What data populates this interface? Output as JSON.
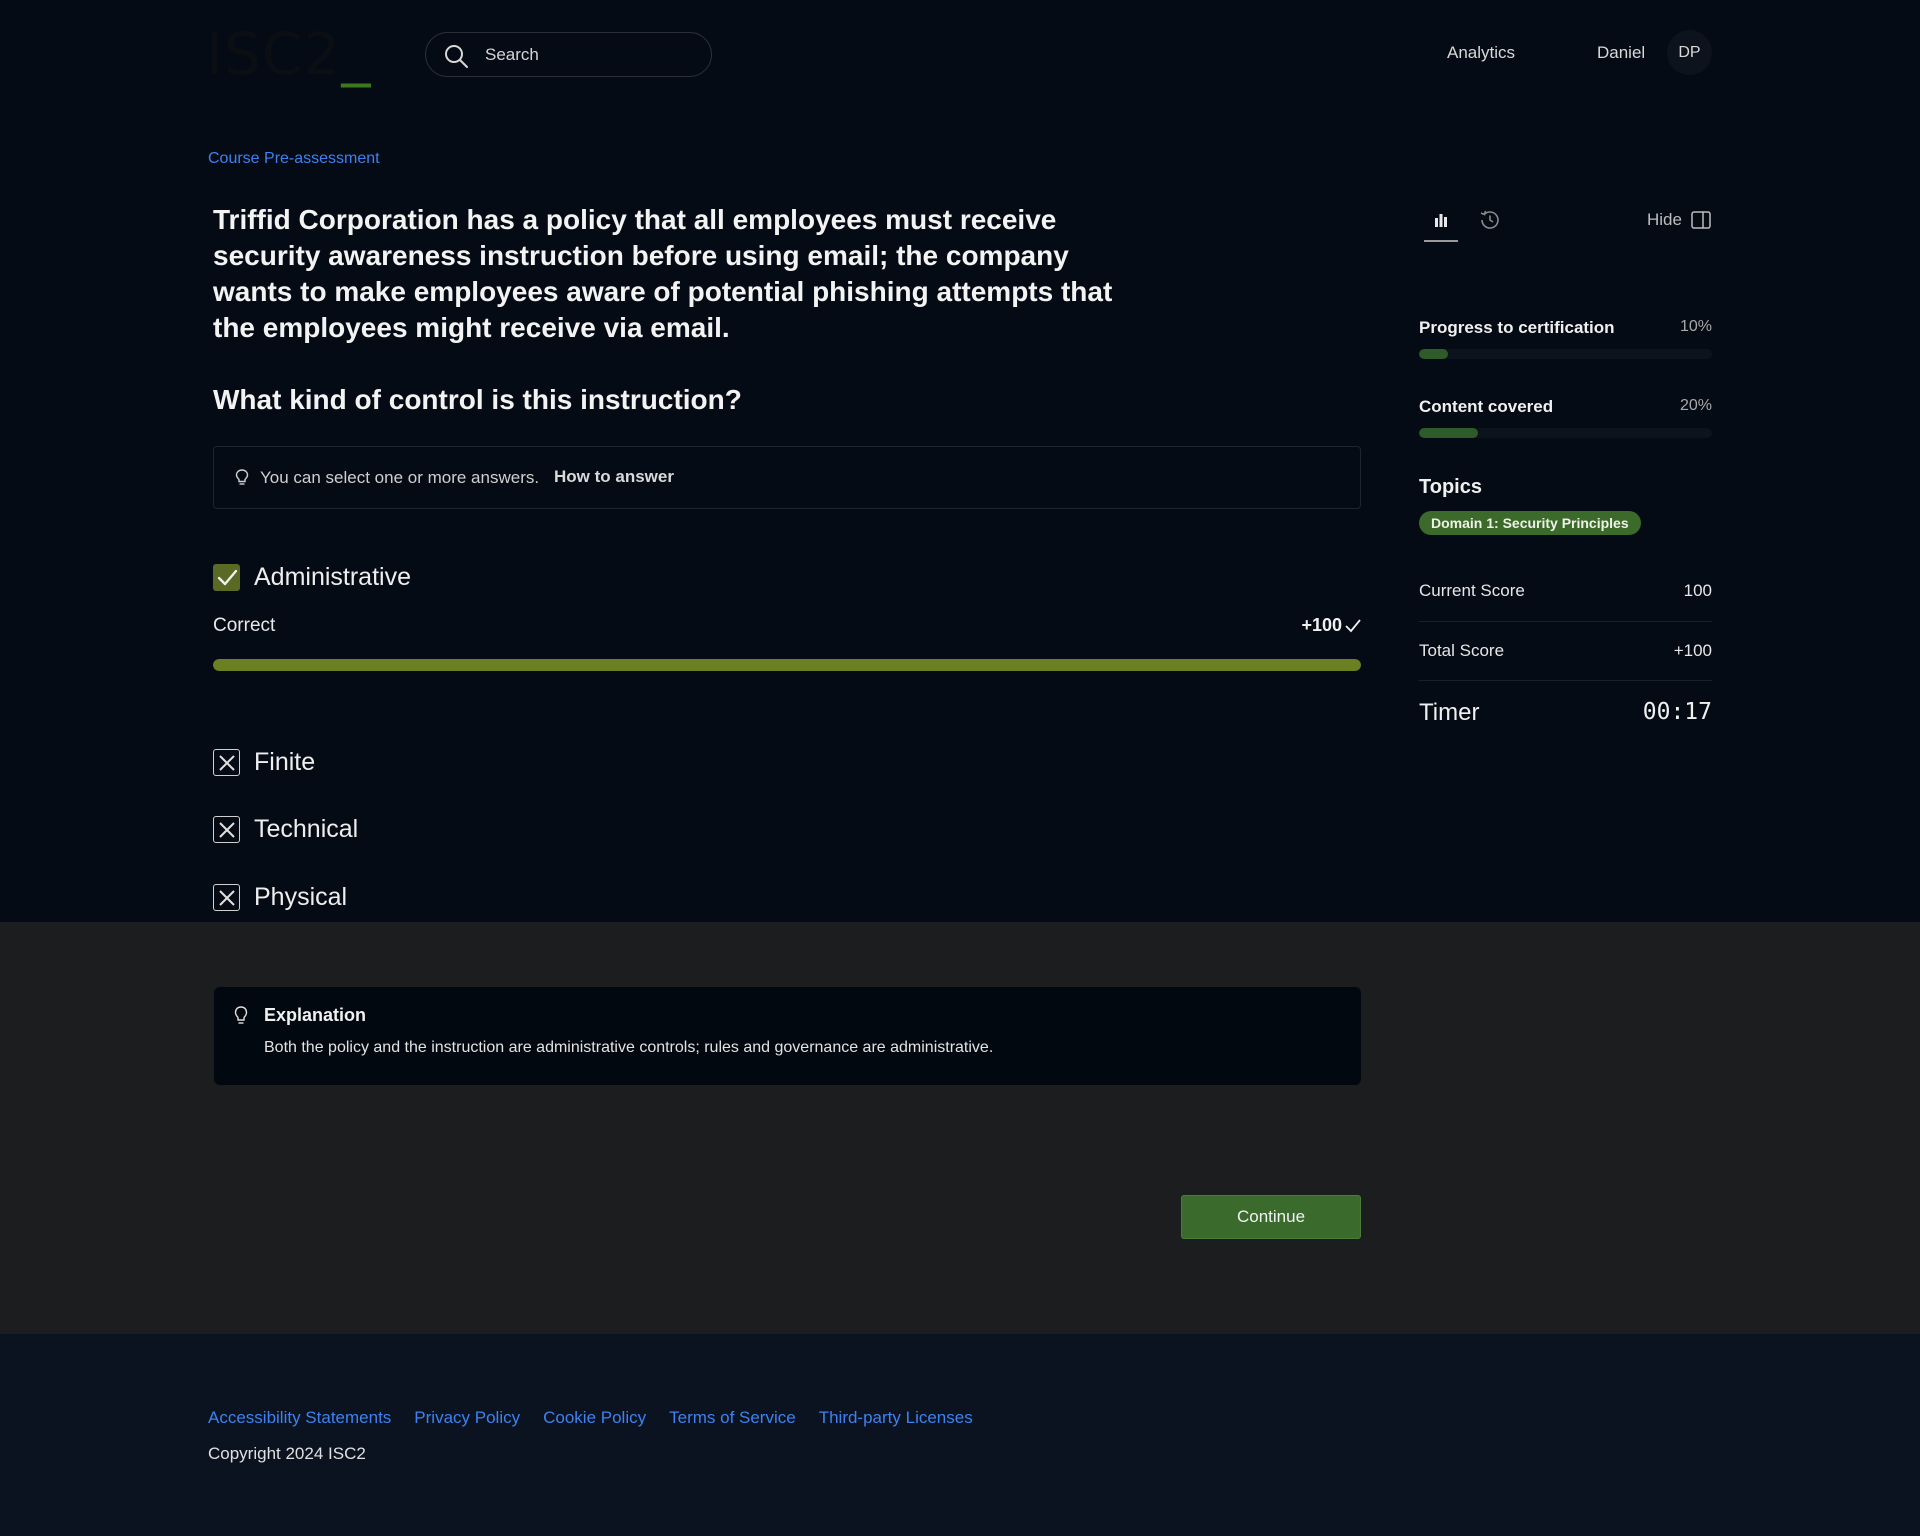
{
  "header": {
    "logo_text": "ISC2",
    "search_placeholder": "Search",
    "nav_analytics": "Analytics",
    "user_name": "Daniel",
    "avatar_initials": "DP"
  },
  "breadcrumb": "Course Pre-assessment",
  "question": {
    "stem": "Triffid Corporation has a policy that all employees must receive security awareness instruction before using email; the company wants to make employees aware of potential phishing attempts that the employees might receive via email.",
    "prompt": "What kind of control is this instruction?",
    "hint_text": "You can select one or more answers.",
    "hint_link": "How to answer"
  },
  "answers": [
    {
      "label": "Administrative",
      "state": "checked"
    },
    {
      "label": "Finite",
      "state": "wrong"
    },
    {
      "label": "Technical",
      "state": "wrong"
    },
    {
      "label": "Physical",
      "state": "wrong"
    }
  ],
  "result": {
    "label": "Correct",
    "score": "+100",
    "fill_percent": 100
  },
  "panel": {
    "hide_label": "Hide",
    "progress_label": "Progress to certification",
    "progress_value": "10%",
    "progress_percent": 10,
    "content_label": "Content covered",
    "content_value": "20%",
    "content_percent": 20,
    "topics_title": "Topics",
    "topic_chip": "Domain 1: Security Principles",
    "current_score_label": "Current Score",
    "current_score_value": "100",
    "total_score_label": "Total Score",
    "total_score_value": "+100",
    "timer_label": "Timer",
    "timer_value": "00:17"
  },
  "explanation": {
    "title": "Explanation",
    "text": "Both the policy and the instruction are administrative controls; rules and governance are administrative."
  },
  "continue_label": "Continue",
  "footer": {
    "links": [
      "Accessibility Statements",
      "Privacy Policy",
      "Cookie Policy",
      "Terms of Service",
      "Third-party Licenses"
    ],
    "copyright": "Copyright 2024 ISC2"
  },
  "colors": {
    "background": "#050b15",
    "link": "#3d82f0",
    "correct_bar": "#6b7f23",
    "accent_green": "#3a6b2c"
  }
}
